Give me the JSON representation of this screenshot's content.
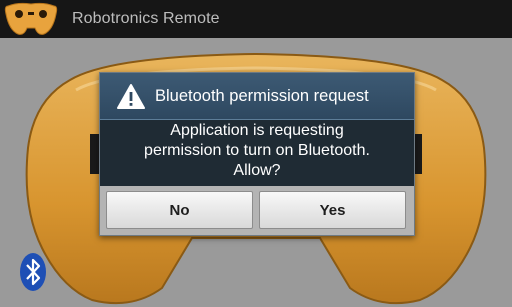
{
  "app": {
    "title": "Robotronics Remote",
    "icon": "gamepad-icon",
    "accent_color": "#e8a33d"
  },
  "status_icon": "bluetooth-icon",
  "dialog": {
    "icon": "warning-icon",
    "title": "Bluetooth permission request",
    "message_lines": [
      "Application is requesting",
      "permission to turn on Bluetooth.",
      "Allow?"
    ],
    "buttons": {
      "no": "No",
      "yes": "Yes"
    }
  }
}
